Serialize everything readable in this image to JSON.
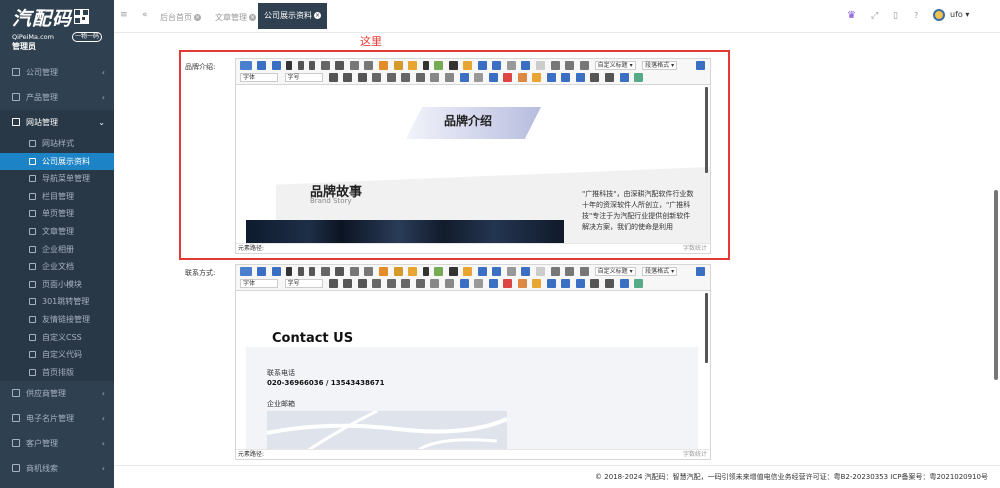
{
  "logo": {
    "text": "汽配码",
    "sub": "QiPeiMa.com",
    "tag": "一物一码"
  },
  "admin_label": "管理员",
  "sidebar": {
    "items": [
      {
        "label": "公司管理",
        "icon": "bank-icon"
      },
      {
        "label": "产品管理",
        "icon": "cart-icon"
      },
      {
        "label": "网站管理",
        "icon": "desktop-icon",
        "open": true
      }
    ],
    "sub_items": [
      {
        "label": "网站样式",
        "icon": "magic-icon"
      },
      {
        "label": "公司展示资料",
        "icon": "search-icon",
        "active": true
      },
      {
        "label": "导航菜单管理",
        "icon": "monitor-icon"
      },
      {
        "label": "栏目管理",
        "icon": "grid-icon"
      },
      {
        "label": "单页管理",
        "icon": "edit-icon"
      },
      {
        "label": "文章管理",
        "icon": "file-icon"
      },
      {
        "label": "企业相册",
        "icon": "camera-icon"
      },
      {
        "label": "企业文档",
        "icon": "picture-icon"
      },
      {
        "label": "页面小模块",
        "icon": "cubes-icon"
      },
      {
        "label": "301跳转管理",
        "icon": "sliders-icon"
      },
      {
        "label": "友情链接管理",
        "icon": "globe-icon"
      },
      {
        "label": "自定义CSS",
        "icon": "leaf-icon"
      },
      {
        "label": "自定义代码",
        "icon": "code-icon"
      },
      {
        "label": "首页排版",
        "icon": "table-icon"
      }
    ],
    "bottom_items": [
      {
        "label": "供应商管理",
        "icon": "circle-icon"
      },
      {
        "label": "电子名片管理",
        "icon": "card-icon"
      },
      {
        "label": "客户管理",
        "icon": "users-icon"
      },
      {
        "label": "商机线索",
        "icon": "link-icon"
      }
    ]
  },
  "topbar": {
    "tabs": [
      {
        "label": "后台首页"
      },
      {
        "label": "文章管理"
      },
      {
        "label": "公司展示资料",
        "active": true
      }
    ],
    "user": "ufo"
  },
  "note": "这里",
  "fields": {
    "brand_label": "品牌介绍:",
    "contact_label": "联系方式:"
  },
  "editor": {
    "font_select": "字体",
    "size_select": "字号",
    "custom_title_select": "自定义标题",
    "paragraph_select": "段落格式",
    "path_label": "元素路径:",
    "word_count": "字数统计"
  },
  "brand_content": {
    "title": "品牌介绍",
    "story_title": "品牌故事",
    "story_sub": "Brand Story",
    "story_text": "\"广推科技\"，由深耕汽配软件行业数十年的资深软件人所创立，\"广推科技\"专注于为汽配行业提供创新软件解决方案，我们的使命是利用"
  },
  "contact_content": {
    "title": "Contact US",
    "phone_label": "联系电话",
    "phone_value": "020-36966036 / 13543438671",
    "email_label": "企业邮箱"
  },
  "footer": "© 2018-2024 汽配码：智慧汽配，一码引领未来增值电信业务经营许可证：粤B2-20230353 ICP备案号：粤2021020910号"
}
